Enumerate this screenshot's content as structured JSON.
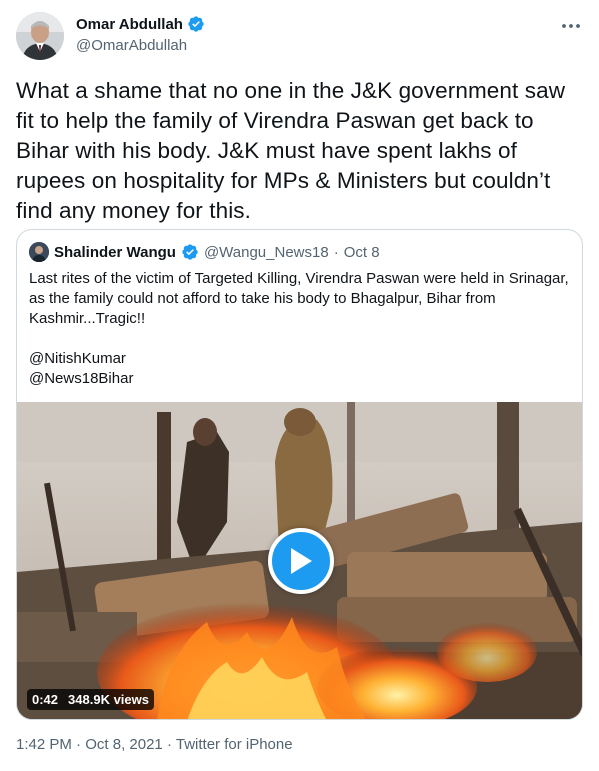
{
  "author": {
    "name": "Omar Abdullah",
    "handle": "@OmarAbdullah",
    "verified": true
  },
  "tweet": {
    "text": "What a shame that no one in the J&K government saw fit to help the family of Virendra Paswan get back to Bihar with his body. J&K must have spent lakhs of rupees on hospitality for MPs & Ministers but couldn’t find any money for this."
  },
  "quoted_tweet": {
    "author_name": "Shalinder Wangu",
    "author_handle": "@Wangu_News18",
    "separator": "·",
    "date": "Oct 8",
    "text": "Last rites of the victim of Targeted Killing, Virendra Paswan were held in Srinagar, as the family could not afford to take his body to Bhagalpur, Bihar from Kashmir...Tragic!!",
    "mentions": [
      "@NitishKumar",
      "@News18Bihar"
    ],
    "video": {
      "duration": "0:42",
      "views": "348.9K views"
    }
  },
  "footer": {
    "time": "1:42 PM",
    "date": "Oct 8, 2021",
    "source": "Twitter for iPhone",
    "separator": "·"
  },
  "colors": {
    "accent": "#1d9bf0",
    "text": "#0f1419",
    "secondary": "#536471",
    "border": "#cfd9de"
  },
  "icons": {
    "verified": "verified-badge-icon",
    "more": "more-options-icon",
    "play": "play-icon"
  }
}
